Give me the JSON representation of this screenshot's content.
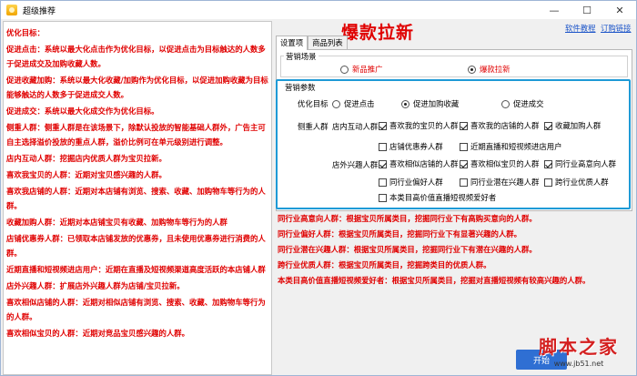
{
  "window": {
    "title": "超级推荐",
    "minimize": "—",
    "maximize": "☐",
    "close": "✕"
  },
  "left_panel": {
    "lines": [
      "优化目标：",
      "促进点击：系统以最大化点击作为优化目标，以促进点击为目标触达的人数多于促进成交及加购收藏人数。",
      "促进收藏加购：系统以最大化收藏/加购作为优化目标，以促进加购收藏为目标能够触达的人数多于促进成交人数。",
      "促进成交：系统以最大化成交作为优化目标。",
      "侧重人群：侧重人群是在该场景下，除默认投放的智能基础人群外，广告主可自主选择溢价投放的重点人群，溢价比例可在单元级别进行调整。",
      "店内互动人群：挖掘店内优质人群为宝贝拉新。",
      "喜欢我宝贝的人群：近期对宝贝感兴趣的人群。",
      "喜欢我店铺的人群：近期对本店铺有浏览、搜索、收藏、加购物车等行为的人群。",
      "收藏加购人群：近期对本店铺宝贝有收藏、加购物车等行为的人群",
      "店铺优惠券人群：已领取本店铺发放的优惠券，且未使用优惠券进行消费的人群。",
      "近期直播和短视频进店用户：近期在直播及短视频渠道高度活跃的本店铺人群",
      "店外兴趣人群：扩展店外兴趣人群为店铺/宝贝拉新。",
      "喜欢相似店铺的人群：近期对相似店铺有浏览、搜索、收藏、加购物车等行为的人群。",
      "喜欢相似宝贝的人群：近期对竞品宝贝感兴趣的人群。"
    ]
  },
  "headline": "爆款拉新",
  "links": {
    "tutorial": "软件教程",
    "subscribe": "订购链接"
  },
  "tabs": [
    "设置项",
    "商品列表"
  ],
  "scene": {
    "legend": "营销场景",
    "options": [
      {
        "label": "新品推广",
        "checked": false
      },
      {
        "label": "爆款拉新",
        "checked": true
      }
    ]
  },
  "params": {
    "legend": "营销参数",
    "goal_label": "优化目标",
    "goals": [
      {
        "label": "促进点击",
        "checked": false
      },
      {
        "label": "促进加购收藏",
        "checked": true
      },
      {
        "label": "促进成交",
        "checked": false
      }
    ],
    "focus_label": "侧重人群",
    "instore_label": "店内互动人群",
    "instore": [
      {
        "label": "喜欢我的宝贝的人群",
        "checked": true
      },
      {
        "label": "喜欢我的店铺的人群",
        "checked": true
      },
      {
        "label": "收藏加购人群",
        "checked": true
      },
      {
        "label": "店铺优惠券人群",
        "checked": false
      },
      {
        "label": "近期直播和短视频进店用户",
        "checked": false
      }
    ],
    "outstore_label": "店外兴趣人群",
    "outstore": [
      {
        "label": "喜欢相似店铺的人群",
        "checked": true
      },
      {
        "label": "喜欢相似宝贝的人群",
        "checked": true
      },
      {
        "label": "同行业高意向人群",
        "checked": true
      },
      {
        "label": "同行业偏好人群",
        "checked": false
      },
      {
        "label": "同行业潜在兴趣人群",
        "checked": false
      },
      {
        "label": "跨行业优质人群",
        "checked": false
      },
      {
        "label": "本类目高价值直播短视频爱好者",
        "checked": false
      }
    ]
  },
  "right_panel": {
    "lines": [
      "同行业高意向人群：根据宝贝所属类目，挖掘同行业下有高购买意向的人群。",
      "同行业偏好人群：根据宝贝所属类目，挖掘同行业下有显著兴趣的人群。",
      "同行业潜在兴趣人群：根据宝贝所属类目，挖掘同行业下有潜在兴趣的人群。",
      "跨行业优质人群：根据宝贝所属类目，挖掘跨类目的优质人群。",
      "本类目高价值直播短视频爱好者：根据宝贝所属类目，挖掘对直播短视频有较高兴趣的人群。"
    ]
  },
  "start_button": "开始",
  "watermark": {
    "logo": "脚本之家",
    "url": "www.jb51.net"
  }
}
